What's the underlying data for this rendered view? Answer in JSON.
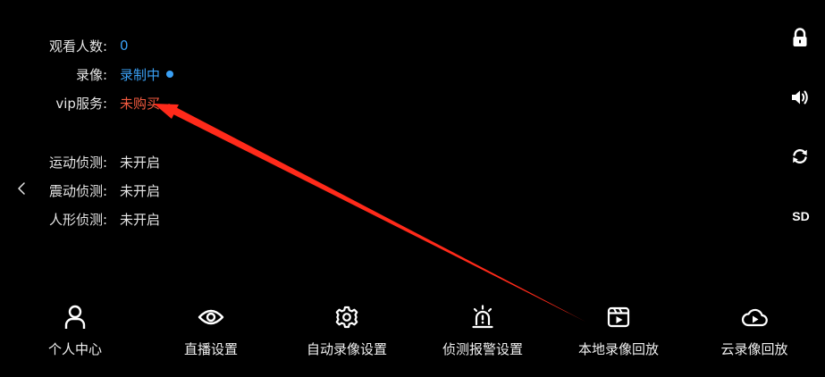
{
  "info": {
    "viewers_label": "观看人数:",
    "viewers_value": "0",
    "record_label": "录像:",
    "record_value": "录制中",
    "vip_label": "vip服务:",
    "vip_value": "未购买",
    "motion_label": "运动侦测:",
    "motion_value": "未开启",
    "vibration_label": "震动侦测:",
    "vibration_value": "未开启",
    "human_label": "人形侦测:",
    "human_value": "未开启"
  },
  "right_controls": {
    "lock_icon": "lock-icon",
    "sound_icon": "speaker-icon",
    "rotate_icon": "refresh-icon",
    "quality_label": "SD"
  },
  "nav": {
    "items": [
      {
        "label": "个人中心",
        "icon": "person-icon"
      },
      {
        "label": "直播设置",
        "icon": "eye-icon"
      },
      {
        "label": "自动录像设置",
        "icon": "gear-icon"
      },
      {
        "label": "侦测报警设置",
        "icon": "alarm-icon"
      },
      {
        "label": "本地录像回放",
        "icon": "video-playback-icon"
      },
      {
        "label": "云录像回放",
        "icon": "cloud-play-icon"
      }
    ]
  },
  "colors": {
    "background": "#000000",
    "accent_blue": "#3aa0f5",
    "alert_red": "#f25a3f",
    "annotation_red": "#ff2a1a"
  }
}
